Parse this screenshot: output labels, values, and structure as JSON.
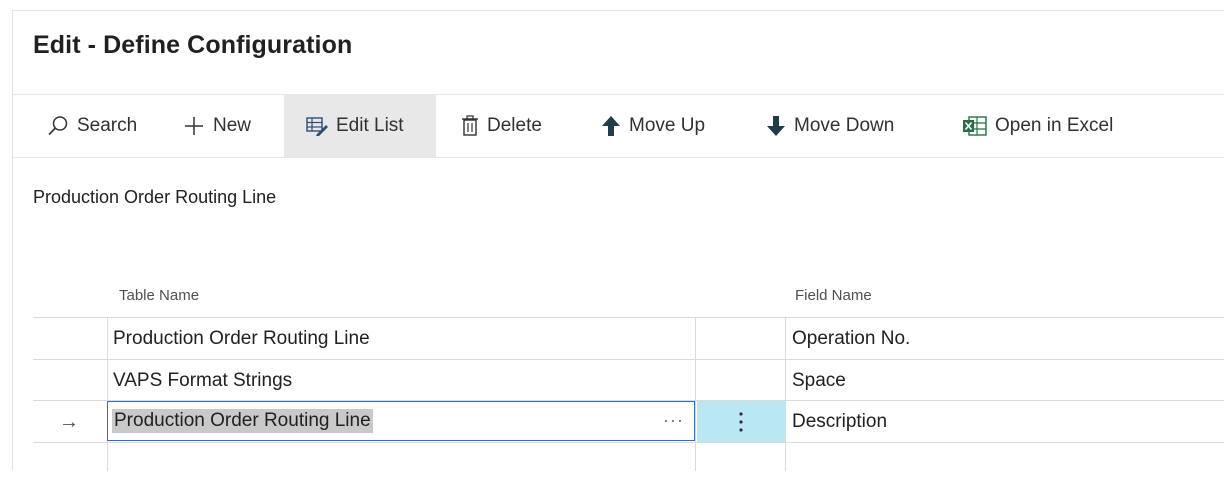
{
  "page": {
    "title": "Edit - Define Configuration",
    "subtitle": "Production Order Routing Line"
  },
  "toolbar": {
    "search_label": "Search",
    "new_label": "New",
    "edit_list_label": "Edit List",
    "delete_label": "Delete",
    "move_up_label": "Move Up",
    "move_down_label": "Move Down",
    "open_in_excel_label": "Open in Excel"
  },
  "table": {
    "headers": {
      "table_name": "Table Name",
      "field_name": "Field Name"
    },
    "rows": [
      {
        "table_name": "Production Order Routing Line",
        "field_name": "Operation No."
      },
      {
        "table_name": "VAPS Format Strings",
        "field_name": "Space"
      },
      {
        "table_name": "Production Order Routing Line",
        "field_name": "Description",
        "selected": true
      },
      {
        "table_name": "",
        "field_name": ""
      }
    ],
    "selected_row_indicator": "→",
    "lookup_ellipsis": "···",
    "row_menu_icon": "vertical-dots-icon"
  },
  "colors": {
    "accent": "#2a6fd6",
    "selected_cell_bg": "#b9e8f3",
    "active_button_bg": "#e8e8e8",
    "icon_dark": "#1f3d4a",
    "excel_green": "#217346"
  }
}
